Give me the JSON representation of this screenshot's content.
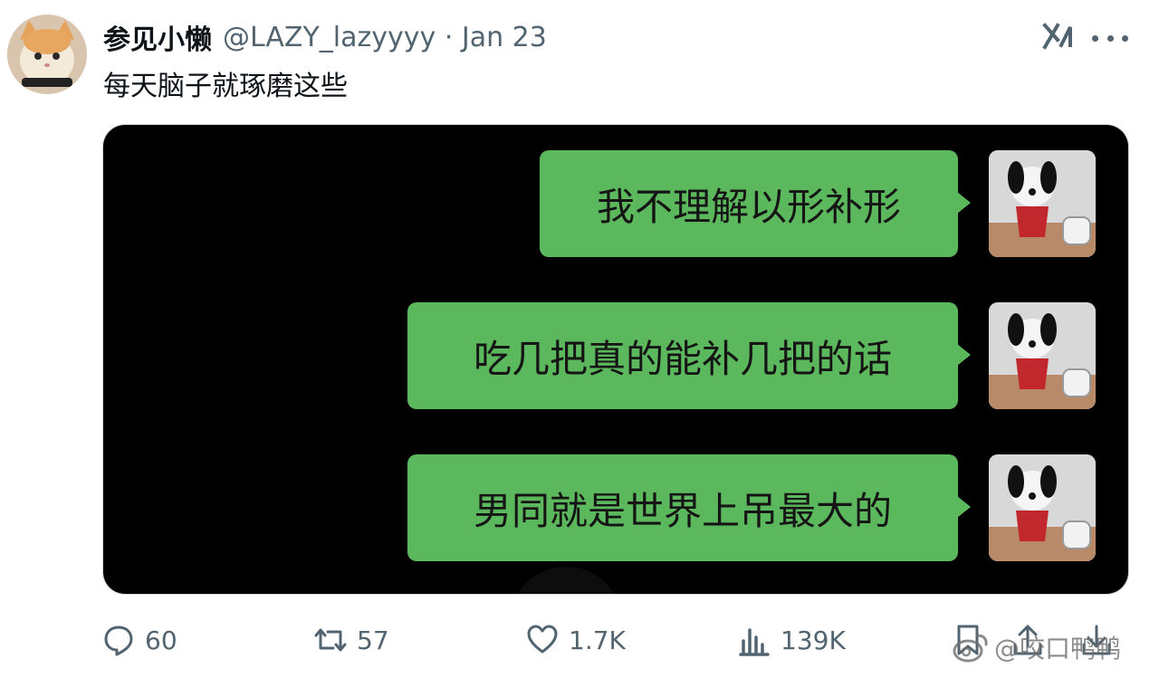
{
  "tweet": {
    "display_name": "参见小懒",
    "handle_meta": "@LAZY_lazyyyy · Jan 23",
    "text": "每天脑子就琢磨这些"
  },
  "chat": {
    "bubbles": [
      "我不理解以形补形",
      "吃几把真的能补几把的话",
      "男同就是世界上吊最大的"
    ]
  },
  "actions": {
    "reply_count": "60",
    "retweet_count": "57",
    "like_count": "1.7K",
    "views_count": "139K"
  },
  "watermark": "@咬口鸭鸭",
  "icons": [
    "grok-icon",
    "more-icon",
    "reply-icon",
    "retweet-icon",
    "like-icon",
    "views-icon",
    "bookmark-icon",
    "share-icon",
    "download-icon",
    "weibo-icon"
  ]
}
